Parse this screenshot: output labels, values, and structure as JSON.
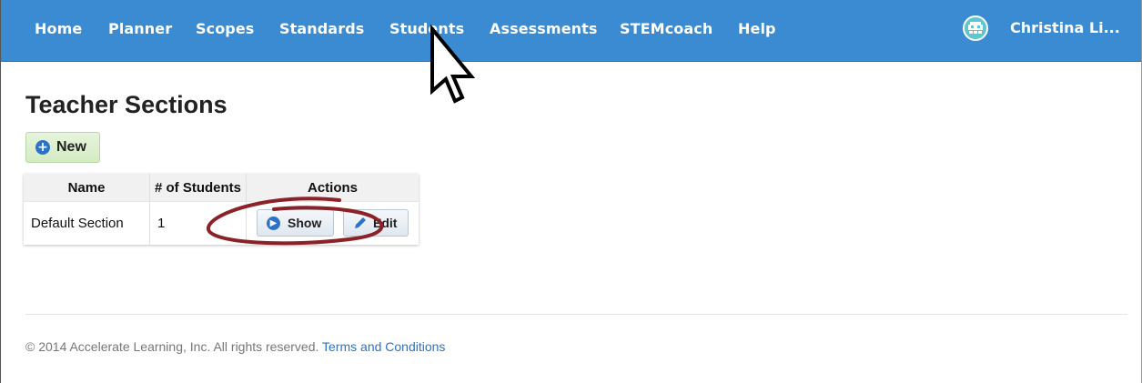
{
  "nav": {
    "items": [
      "Home",
      "Planner",
      "Scopes",
      "Standards",
      "Students",
      "Assessments",
      "STEMcoach",
      "Help"
    ],
    "user_name": "Christina Li...",
    "avatar_icon": "pixel-avatar-icon"
  },
  "page": {
    "title": "Teacher Sections",
    "new_button_label": "New"
  },
  "table": {
    "headers": [
      "Name",
      "# of Students",
      "Actions"
    ],
    "rows": [
      {
        "name": "Default Section",
        "students": "1"
      }
    ],
    "show_label": "Show",
    "edit_label": "Edit"
  },
  "footer": {
    "copyright": "© 2014 Accelerate Learning, Inc. All rights reserved.",
    "terms_link": "Terms and Conditions"
  },
  "colors": {
    "navbar": "#3a8bd2",
    "annotation": "#8b2228",
    "link": "#2a72c9"
  }
}
